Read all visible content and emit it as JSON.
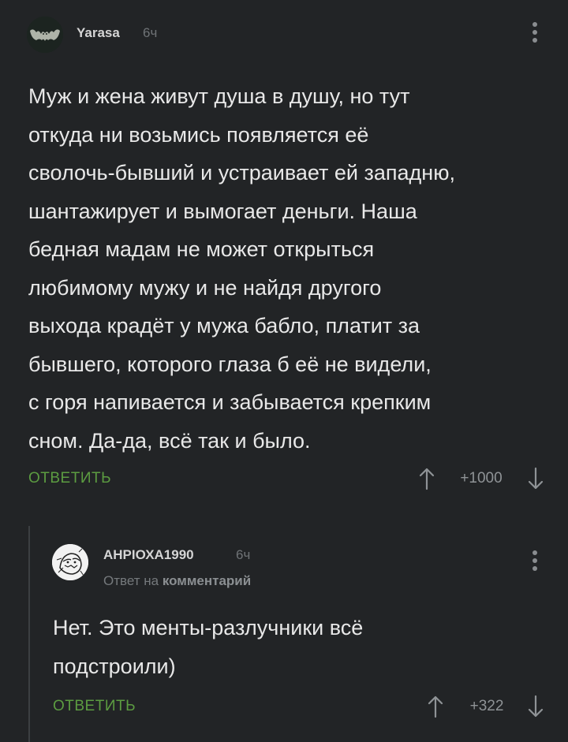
{
  "comments": [
    {
      "username": "Yarasa",
      "time": "6ч",
      "text": "Муж и жена живут душа в душу, но тут\nоткуда ни возьмись появляется её\nсволочь-бывший и устраивает ей западню,\nшантажирует и вымогает деньги. Наша\nбедная мадам не может открыться\nлюбимому мужу и не найдя другого\nвыхода крадёт у мужа бабло, платит за\nбывшего, которого глаза б её не видели,\nс горя напивается и забывается крепким\nсном. Да-да, всё так и было.",
      "reply_label": "ОТВЕТИТЬ",
      "rating": "+1000"
    },
    {
      "username": "АНРIОХА1990",
      "time": "6ч",
      "reply_to_prefix": "Ответ на",
      "reply_to_link": "комментарий",
      "text": "Нет. Это менты-разлучники всё\nподстроили)",
      "reply_label": "ОТВЕТИТЬ",
      "rating": "+322"
    }
  ],
  "icons": {
    "up": "arrow-up-icon",
    "down": "arrow-down-icon",
    "more": "more-vertical-icon"
  },
  "colors": {
    "background": "#222426",
    "text": "#e8e8e8",
    "accent_green": "#5c9c41",
    "muted": "#6f7376"
  }
}
